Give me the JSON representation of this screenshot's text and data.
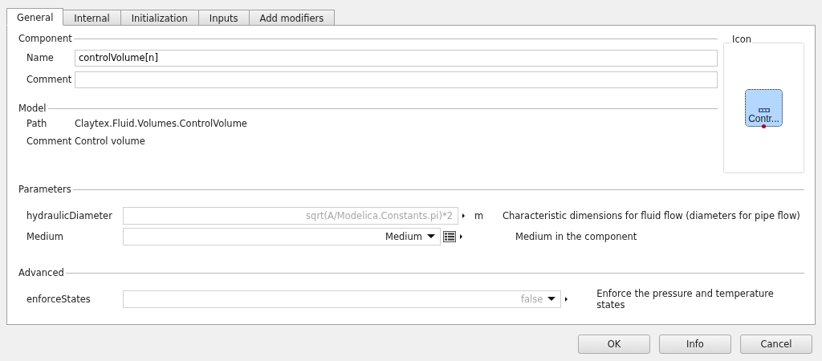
{
  "tabs": [
    {
      "label": "General",
      "selected": true
    },
    {
      "label": "Internal",
      "selected": false
    },
    {
      "label": "Initialization",
      "selected": false
    },
    {
      "label": "Inputs",
      "selected": false
    },
    {
      "label": "Add modifiers",
      "selected": false
    }
  ],
  "component": {
    "title": "Component",
    "fields": [
      {
        "label": "Name",
        "value": "controlVolume[n]"
      },
      {
        "label": "Comment"
      }
    ]
  },
  "icon": {
    "title": "Icon",
    "caption": "Contr..."
  },
  "model": {
    "title": "Model",
    "rows": [
      {
        "label": "Path",
        "value": "Claytex.Fluid.Volumes.ControlVolume"
      },
      {
        "label": "Comment",
        "value": "Control volume"
      }
    ]
  },
  "parameters": {
    "title": "Parameters",
    "rows": [
      {
        "kind": "expression",
        "name": "hydraulicDiameter",
        "placeholder": "sqrt(A/Modelica.Constants.pi)*2",
        "unit": "m",
        "description": "Characteristic dimensions for fluid flow (diameters for pipe flow)"
      },
      {
        "kind": "choice",
        "name": "Medium",
        "value": "Medium",
        "description": "Medium in the component"
      }
    ]
  },
  "advanced": {
    "title": "Advanced",
    "rows": [
      {
        "kind": "boolean",
        "name": "enforceStates",
        "placeholder": "false",
        "description": "Enforce the pressure and temperature states"
      }
    ]
  },
  "buttons": [
    "OK",
    "Info",
    "Cancel"
  ]
}
